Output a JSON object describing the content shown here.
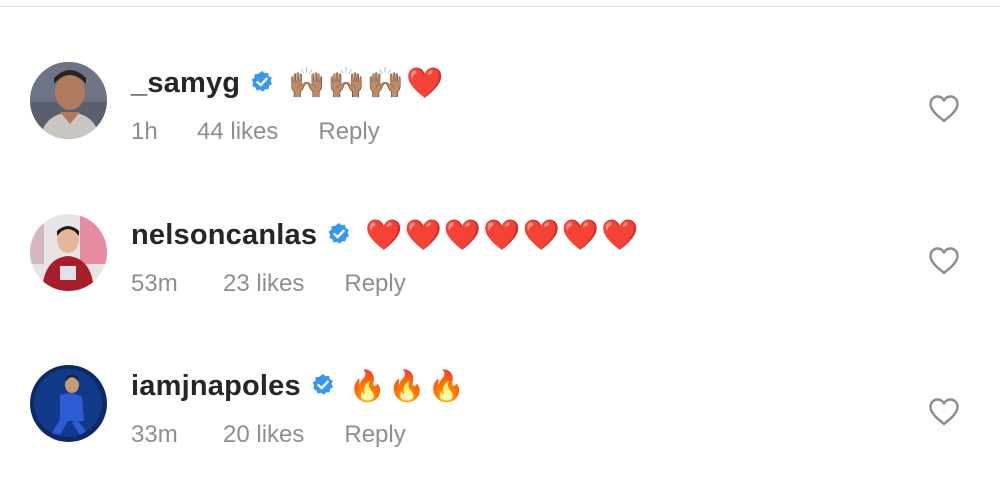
{
  "comments": [
    {
      "username": "_samyg",
      "verified": true,
      "text": "🙌🏽🙌🏽🙌🏽❤️",
      "time": "1h",
      "likes": "44 likes",
      "reply": "Reply",
      "avatar_icon": "profile-photo"
    },
    {
      "username": "nelsoncanlas",
      "verified": true,
      "text": "❤️❤️❤️❤️❤️❤️❤️",
      "time": "53m",
      "likes": "23 likes",
      "reply": "Reply",
      "avatar_icon": "profile-photo"
    },
    {
      "username": "iamjnapoles",
      "verified": true,
      "text": "🔥🔥🔥",
      "time": "33m",
      "likes": "20 likes",
      "reply": "Reply",
      "avatar_icon": "profile-photo"
    }
  ],
  "icons": {
    "verified": "verified-badge-icon",
    "like": "heart-outline-icon"
  },
  "colors": {
    "username": "#262626",
    "meta": "#8e8e8e",
    "verified_blue": "#3897f0",
    "heart_outline": "#8e8e8e"
  }
}
